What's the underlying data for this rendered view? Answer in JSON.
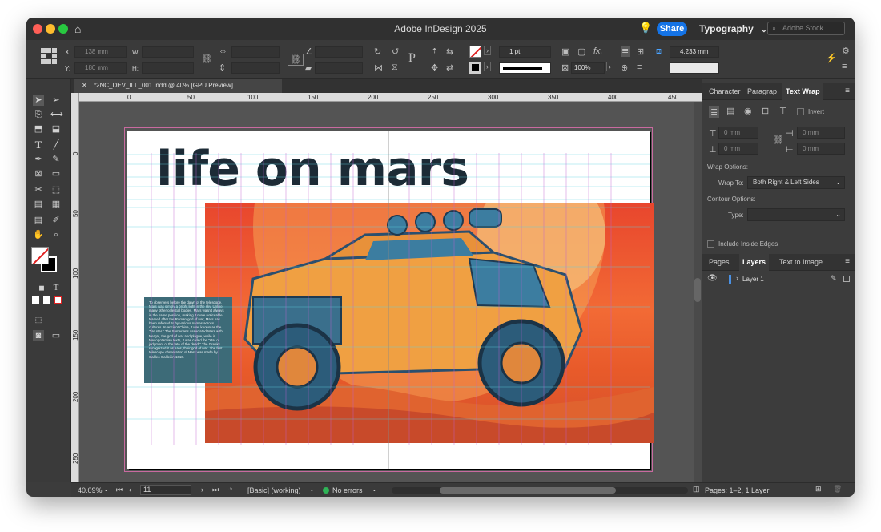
{
  "app": {
    "title": "Adobe InDesign 2025",
    "share_label": "Share",
    "workspace": "Typography",
    "stock_placeholder": "Adobe Stock"
  },
  "control": {
    "x_label": "X:",
    "x_value": "138 mm",
    "y_label": "Y:",
    "y_value": "180 mm",
    "w_label": "W:",
    "h_label": "H:",
    "stroke_weight": "1 pt",
    "zoom_percent": "100%",
    "gutter_value": "4.233 mm"
  },
  "document": {
    "tab_title": "*2NC_DEV_ILL_001.indd @ 40% [GPU Preview]"
  },
  "ruler": {
    "h_ticks": [
      "0",
      "50",
      "100",
      "150",
      "200",
      "250",
      "300",
      "350",
      "400",
      "450"
    ],
    "v_ticks": [
      "0",
      "50",
      "100",
      "150",
      "200",
      "250"
    ]
  },
  "page": {
    "headline": "life on mars",
    "caption": "To observers before the dawn of the telescope, Mars was simply a bright light in the sky. Unlike many other celestial bodies, Mars wasn't always in the same position, making it more noticeable. Named after the Roman god of war, Mars has been referred to by various names across cultures. In ancient China, it was known as the \"fire star.\" The Sumerians associated Mars with Nergal, the god of war and plague, while in Mesopotamian texts, it was called the \"star of judgment of the fate of the dead.\" The Greeks recognized it as Ares, their god of war. The first telescope observation of Mars was made by Galileo Galilei in 1610."
  },
  "panel_top": {
    "tabs": [
      "Character",
      "Paragrap",
      "Text Wrap"
    ],
    "invert_label": "Invert",
    "offset_top": "0 mm",
    "offset_bottom": "0 mm",
    "offset_left": "0 mm",
    "offset_right": "0 mm",
    "wrap_options_label": "Wrap Options:",
    "wrap_to_label": "Wrap To:",
    "wrap_to_value": "Both Right & Left Sides",
    "contour_options_label": "Contour Options:",
    "type_label": "Type:",
    "include_inside_edges": "Include Inside Edges"
  },
  "panel_bottom": {
    "tabs": [
      "Pages",
      "Layers",
      "Text to Image"
    ],
    "layer_name": "Layer 1",
    "status": "Pages: 1–2, 1 Layer"
  },
  "status": {
    "zoom": "40.09%",
    "page_number": "11",
    "preflight_profile": "[Basic] (working)",
    "errors": "No errors"
  },
  "colors": {
    "accent": "#1473e6",
    "caption_bg": "#3d6b78",
    "status_ok": "#2fb457",
    "guide": "#5fd0e0",
    "margin": "#c060d0"
  }
}
